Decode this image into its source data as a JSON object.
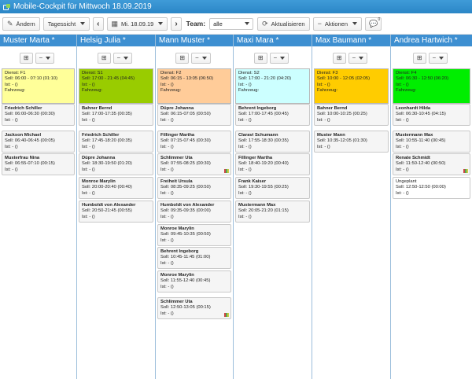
{
  "title": "Mobile-Cockpit für Mittwoch 18.09.2019",
  "toolbar": {
    "edit_label": "Ändern",
    "view_label": "Tagessicht",
    "date_label": "Mi. 18.09.19",
    "team_label": "Team:",
    "team_value": "alle",
    "refresh_label": "Aktualisieren",
    "actions_label": "Aktionen",
    "chat_badge": "0"
  },
  "columns": [
    {
      "name": "Muster Marta *",
      "dienst": {
        "line1": "Dienst: F1",
        "line2": "Soll: 06:00 - 07:10  (01:10)",
        "line3": "Ist:  -  ()",
        "line4": "Fahrzeug:",
        "color": "#ffff99"
      },
      "cards": [
        {
          "name": "Friedrich Schiller",
          "soll": "Soll: 06:00-06:30  (00:30)",
          "ist": "Ist:  -  ()"
        },
        {
          "name": "Jackson Michael",
          "soll": "Soll: 06:40-06:45  (00:05)",
          "ist": "Ist:  -  ()"
        },
        {
          "name": "Musterfrau Nina",
          "soll": "Soll: 06:55-07:10  (00:15)",
          "ist": "Ist:  -  ()"
        }
      ]
    },
    {
      "name": "Helsig Julia *",
      "dienst": {
        "line1": "Dienst: S1",
        "line2": "Soll: 17:00 - 21:45  (04:45)",
        "line3": "Ist:  -  ()",
        "line4": "Fahrzeug:",
        "color": "#99cc00"
      },
      "cards": [
        {
          "name": "Bahner Bernd",
          "soll": "Soll: 17:00-17:35  (00:35)",
          "ist": "Ist:  -  ()"
        },
        {
          "name": "Friedrich Schiller",
          "soll": "Soll: 17:45-18:20  (00:35)",
          "ist": "Ist:  -  ()"
        },
        {
          "name": "Düpre Johanna",
          "soll": "Soll: 18:30-19:50  (01:20)",
          "ist": "Ist:  -  ()"
        },
        {
          "name": "Monroe Marylin",
          "soll": "Soll: 20:00-20:40  (00:40)",
          "ist": "Ist:  -  ()"
        },
        {
          "name": "Humboldt von Alexander",
          "soll": "Soll: 20:50-21:45  (00:55)",
          "ist": "Ist:  -  ()"
        }
      ]
    },
    {
      "name": "Mann Muster *",
      "dienst": {
        "line1": "Dienst: F2",
        "line2": "Soll: 06:15 - 13:05  (06:50)",
        "line3": "Ist:  -  ()",
        "line4": "Fahrzeug:",
        "color": "#ffcc99"
      },
      "cards": [
        {
          "name": "Düpre Johanna",
          "soll": "Soll: 06:15-07:05  (00:50)",
          "ist": "Ist:  -  ()"
        },
        {
          "name": "Fillinger Martha",
          "soll": "Soll: 07:15-07:45  (00:30)",
          "ist": "Ist:  -  ()"
        },
        {
          "name": "Schlimmer Uta",
          "soll": "Soll: 07:55-08:25  (00:30)",
          "ist": "Ist:  -  ()",
          "flag": true
        },
        {
          "name": "Freiheit Ursula",
          "soll": "Soll: 08:35-09:25  (00:50)",
          "ist": "Ist:  -  ()"
        },
        {
          "name": "Humboldt von Alexander",
          "soll": "Soll: 09:35-09:35  (00:00)",
          "ist": "Ist:  -  ()"
        },
        {
          "name": "Monroe Marylin",
          "soll": "Soll: 09:45-10:35  (00:50)",
          "ist": "Ist:  -  ()"
        },
        {
          "name": "Behrent Ingeborg",
          "soll": "Soll: 10:45-11:45  (01:00)",
          "ist": "Ist:  -  ()"
        },
        {
          "name": "Monroe Marylin",
          "soll": "Soll: 11:55-12:40  (00:45)",
          "ist": "Ist:  -  ()"
        },
        {
          "name": "Schlimmer Uta",
          "soll": "Soll: 12:50-13:05  (00:15)",
          "ist": "Ist:  -  ()",
          "flag": true
        }
      ]
    },
    {
      "name": "Maxi Mara *",
      "dienst": {
        "line1": "Dienst: S2",
        "line2": "Soll: 17:00 - 21:20  (04:20)",
        "line3": "Ist:  -  ()",
        "line4": "Fahrzeug:",
        "color": "#ccffff"
      },
      "cards": [
        {
          "name": "Behrent Ingeborg",
          "soll": "Soll: 17:00-17:45  (00:45)",
          "ist": "Ist:  -  ()"
        },
        {
          "name": "Claravi Schumann",
          "soll": "Soll: 17:55-18:30  (00:35)",
          "ist": "Ist:  -  ()"
        },
        {
          "name": "Fillinger Martha",
          "soll": "Soll: 18:40-19:20  (00:40)",
          "ist": "Ist:  -  ()"
        },
        {
          "name": "Frank Kaiser",
          "soll": "Soll: 19:30-19:55  (00:25)",
          "ist": "Ist:  -  ()"
        },
        {
          "name": "Mustermann Max",
          "soll": "Soll: 20:05-21:20  (01:15)",
          "ist": "Ist:  -  ()"
        }
      ]
    },
    {
      "name": "Max Baumann *",
      "dienst": {
        "line1": "Dienst: F3",
        "line2": "Soll: 10:00 - 12:05  (02:05)",
        "line3": "Ist:  -  ()",
        "line4": "Fahrzeug:",
        "color": "#ffcc00"
      },
      "cards": [
        {
          "name": "Bahner Bernd",
          "soll": "Soll: 10:00-10:25  (00:25)",
          "ist": "Ist:  -  ()"
        },
        {
          "name": "Muster Mann",
          "soll": "Soll: 10:35-12:05  (01:30)",
          "ist": "Ist:  -  ()"
        }
      ]
    },
    {
      "name": "Andrea Hartwich *",
      "dienst": {
        "line1": "Dienst: F4",
        "line2": "Soll: 06:30 - 12:50  (06:20)",
        "line3": "Ist:  -  ()",
        "line4": "Fahrzeug:",
        "color": "#00ee00"
      },
      "cards": [
        {
          "name": "Leonhardt Hilda",
          "soll": "Soll: 06:30-10:45  (04:15)",
          "ist": "Ist:  -  ()"
        },
        {
          "name": "Mustermann Max",
          "soll": "Soll: 10:55-11:40  (00:45)",
          "ist": "Ist:  -  ()"
        },
        {
          "name": "Renate Schmidt",
          "soll": "Soll: 11:50-12:40  (00:50)",
          "ist": "Ist:  -  ()",
          "flag": true
        },
        {
          "name": "Ungeplant",
          "soll": "Soll: 12:50-12:50  (00:00)",
          "ist": "Ist:  -  ()",
          "plain": true
        }
      ]
    }
  ]
}
